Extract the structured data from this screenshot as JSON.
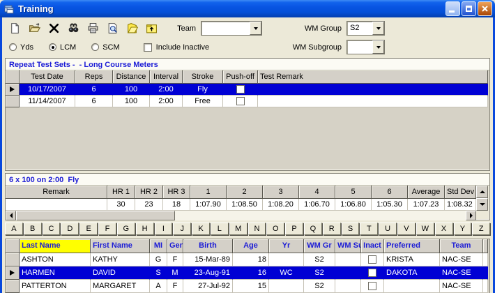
{
  "window": {
    "title": "Training"
  },
  "titlebar": {
    "buttons": [
      "minimize",
      "maximize",
      "close"
    ]
  },
  "toolbar": {
    "icons": [
      "new-icon",
      "open-icon",
      "delete-icon",
      "find-icon",
      "print-icon",
      "preview-icon",
      "notes-icon",
      "exit-icon"
    ],
    "team_label": "Team",
    "team_value": "",
    "wm_group_label": "WM Group",
    "wm_group_value": "S2",
    "wm_subgroup_label": "WM Subgroup",
    "wm_subgroup_value": ""
  },
  "filters": {
    "course_options": [
      {
        "label": "Yds",
        "selected": false
      },
      {
        "label": "LCM",
        "selected": true
      },
      {
        "label": "SCM",
        "selected": false
      }
    ],
    "include_inactive_label": "Include Inactive",
    "include_inactive_checked": false
  },
  "test_sets": {
    "title": "Repeat Test Sets -  - Long Course Meters",
    "columns": [
      "Test Date",
      "Reps",
      "Distance",
      "Interval",
      "Stroke",
      "Push-off",
      "Test Remark"
    ],
    "rows": [
      {
        "cells": [
          "10/17/2007",
          "6",
          "100",
          "2:00",
          "Fly",
          "",
          ""
        ],
        "selected": true
      },
      {
        "cells": [
          "11/14/2007",
          "6",
          "100",
          "2:00",
          "Free",
          "",
          ""
        ],
        "selected": false
      }
    ]
  },
  "set_detail": {
    "title": "6 x 100 on 2:00  Fly",
    "columns": [
      "Remark",
      "HR 1",
      "HR 2",
      "HR 3",
      "1",
      "2",
      "3",
      "4",
      "5",
      "6",
      "Average",
      "Std Dev"
    ],
    "rows": [
      {
        "cells": [
          "",
          "30",
          "23",
          "18",
          "1:07.90",
          "1:08.50",
          "1:08.20",
          "1:06.70",
          "1:06.80",
          "1:05.30",
          "1:07.23",
          "1:08.32"
        ],
        "selected": false
      }
    ]
  },
  "alphabet": [
    "A",
    "B",
    "C",
    "D",
    "E",
    "F",
    "G",
    "H",
    "I",
    "J",
    "K",
    "L",
    "M",
    "N",
    "O",
    "P",
    "Q",
    "R",
    "S",
    "T",
    "U",
    "V",
    "W",
    "X",
    "Y",
    "Z"
  ],
  "swimmers": {
    "columns": [
      "Last Name",
      "First Name",
      "MI",
      "Gen",
      "Birth",
      "Age",
      "Yr",
      "WM Gr",
      "WM Sub",
      "Inact",
      "Preferred",
      "Team"
    ],
    "rows": [
      {
        "cells": [
          "ASHTON",
          "KATHY",
          "G",
          "F",
          "15-Mar-89",
          "18",
          "",
          "S2",
          "",
          "",
          "KRISTA",
          "NAC-SE"
        ],
        "selected": false
      },
      {
        "cells": [
          "HARMEN",
          "DAVID",
          "S",
          "M",
          "23-Aug-91",
          "16",
          "WC",
          "S2",
          "",
          "",
          "DAKOTA",
          "NAC-SE"
        ],
        "selected": true
      },
      {
        "cells": [
          "PATTERTON",
          "MARGARET",
          "A",
          "F",
          "27-Jul-92",
          "15",
          "",
          "S2",
          "",
          "",
          "",
          "NAC-SE"
        ],
        "selected": false
      }
    ]
  },
  "colors": {
    "selection": "#0000D4",
    "titlebar_blue": "#0854E2",
    "window_border": "#0848DD",
    "panel_beige": "#ECE9D8",
    "grid_header_gray": "#D4D0C8",
    "header_text_blue": "#1C1CD6",
    "sort_column_yellow": "#FFFF00"
  }
}
